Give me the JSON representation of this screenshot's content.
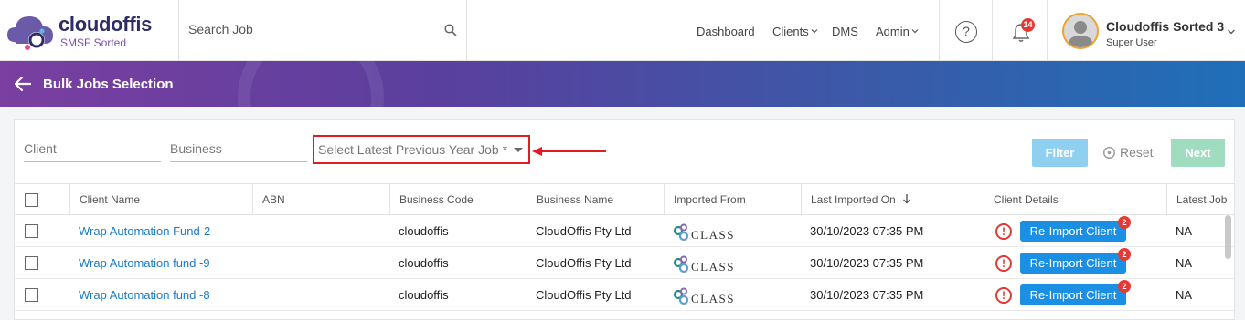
{
  "brand": {
    "name": "cloudoffis",
    "tagline": "SMSF Sorted"
  },
  "search": {
    "placeholder": "Search Job"
  },
  "nav": [
    {
      "label": "Dashboard",
      "has_dropdown": false
    },
    {
      "label": "Clients",
      "has_dropdown": true
    },
    {
      "label": "DMS",
      "has_dropdown": false
    },
    {
      "label": "Admin",
      "has_dropdown": true
    }
  ],
  "header": {
    "help_icon": "?",
    "notifications_count": "14"
  },
  "user": {
    "name": "Cloudoffis Sorted 3",
    "role": "Super User"
  },
  "page": {
    "title": "Bulk Jobs Selection"
  },
  "filters": {
    "client_placeholder": "Client",
    "business_placeholder": "Business",
    "previous_year_job_placeholder": "Select Latest Previous Year Job *",
    "filter_label": "Filter",
    "reset_label": "Reset",
    "next_label": "Next"
  },
  "table": {
    "columns": [
      "Client Name",
      "ABN",
      "Business Code",
      "Business Name",
      "Imported From",
      "Last Imported On",
      "Client Details",
      "Latest Job"
    ],
    "rows": [
      {
        "client_name": "Wrap Automation Fund-2",
        "abn": "",
        "business_code": "cloudoffis",
        "business_name": "CloudOffis Pty Ltd",
        "imported_from": "CLASS",
        "last_imported_on": "30/10/2023 07:35 PM",
        "action": "Re-Import Client",
        "action_badge": "2",
        "latest_job": "NA"
      },
      {
        "client_name": "Wrap Automation fund -9",
        "abn": "",
        "business_code": "cloudoffis",
        "business_name": "CloudOffis Pty Ltd",
        "imported_from": "CLASS",
        "last_imported_on": "30/10/2023 07:35 PM",
        "action": "Re-Import Client",
        "action_badge": "2",
        "latest_job": "NA"
      },
      {
        "client_name": "Wrap Automation fund -8",
        "abn": "",
        "business_code": "cloudoffis",
        "business_name": "CloudOffis Pty Ltd",
        "imported_from": "CLASS",
        "last_imported_on": "30/10/2023 07:35 PM",
        "action": "Re-Import Client",
        "action_badge": "2",
        "latest_job": "NA"
      }
    ]
  },
  "colors": {
    "accent_red": "#e31b23",
    "link_blue": "#1a7bc8",
    "button_blue": "#1a8fe3",
    "filter_btn": "#8fd0f0",
    "next_btn": "#9fdcc0"
  }
}
